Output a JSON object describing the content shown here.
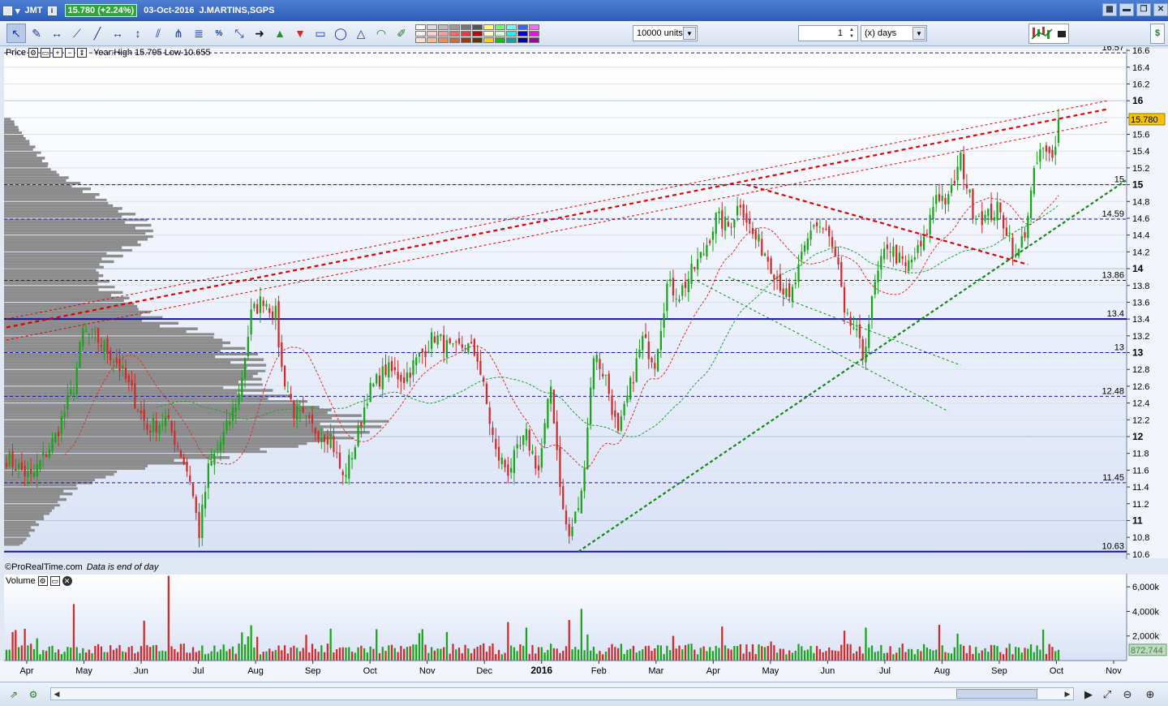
{
  "titlebar": {
    "symbol": "JMT",
    "price_badge": "15.780 (+2.24%)",
    "date": "03-Oct-2016",
    "instrument": "J.MARTINS,SGPS"
  },
  "toolbar": {
    "units_value": "10000 units",
    "period_value": "1",
    "period_unit": "(x) days",
    "swatch_colors": [
      "#ffffff",
      "#dddddd",
      "#bbbbbb",
      "#999999",
      "#777777",
      "#555555",
      "#ffff66",
      "#66ff66",
      "#66ffff",
      "#3366ff",
      "#ff66ff",
      "#ffeeee",
      "#ffcccc",
      "#ff9999",
      "#ff6666",
      "#ff3333",
      "#cc0000",
      "#ffffcc",
      "#ccffcc",
      "#00ffff",
      "#0000ff",
      "#ff00ff",
      "#ffe0cc",
      "#ffbb88",
      "#ff8844",
      "#dd6622",
      "#aa3300",
      "#663300",
      "#ffcc00",
      "#00cc00",
      "#00aaaa",
      "#0000aa",
      "#aa00aa"
    ]
  },
  "price_panel": {
    "label": "Price",
    "year_info": "Year:High 15.795 Low 10.655",
    "credit": "©ProRealTime.com",
    "credit_note": "Data is end of day"
  },
  "volume_panel": {
    "label": "Volume"
  },
  "colors": {
    "up": "#19a519",
    "down": "#d12a2a",
    "hline": "#1515a0",
    "resistance": "#e00000",
    "support": "#128a12",
    "profile": "#8c8c8c",
    "last_price": "#f5c400"
  },
  "chart_data": {
    "type": "candlestick",
    "title": "JMT 03-Oct-2016 J.MARTINS,SGPS",
    "y_range": [
      10.55,
      16.62
    ],
    "y_ticks": [
      16.6,
      16.4,
      16.2,
      16,
      15.8,
      15.6,
      15.4,
      15.2,
      15,
      14.8,
      14.6,
      14.4,
      14.2,
      14,
      13.8,
      13.6,
      13.4,
      13.2,
      13,
      12.8,
      12.6,
      12.4,
      12.2,
      12,
      11.8,
      11.6,
      11.4,
      11.2,
      11,
      10.8,
      10.6
    ],
    "y_ticks_bold": [
      16,
      15,
      14,
      13,
      12,
      11
    ],
    "x_labels": [
      "Apr",
      "May",
      "Jun",
      "Jul",
      "Aug",
      "Sep",
      "Oct",
      "Nov",
      "Dec",
      "2016",
      "Feb",
      "Mar",
      "Apr",
      "May",
      "Jun",
      "Jul",
      "Aug",
      "Sep",
      "Oct",
      "Nov"
    ],
    "x_bold": "2016",
    "horizontal_levels": [
      {
        "value": 16.57,
        "label": "16.57",
        "style": "dashed"
      },
      {
        "value": 15.0,
        "label": "15",
        "style": "dashed"
      },
      {
        "value": 14.59,
        "label": "14.59",
        "style": "dashed"
      },
      {
        "value": 13.86,
        "label": "13.86",
        "style": "dashed"
      },
      {
        "value": 13.4,
        "label": "13.4",
        "style": "solid"
      },
      {
        "value": 13.0,
        "label": "13",
        "style": "dashed"
      },
      {
        "value": 12.48,
        "label": "12.48",
        "style": "dashed"
      },
      {
        "value": 11.45,
        "label": "11.45",
        "style": "dashed"
      },
      {
        "value": 10.63,
        "label": "10.63",
        "style": "solid"
      }
    ],
    "last_price": {
      "value": 15.78,
      "label": "15.780"
    },
    "anchors": [
      {
        "x": 0,
        "v": 11.75
      },
      {
        "x": 8,
        "v": 11.5
      },
      {
        "x": 16,
        "v": 12.0
      },
      {
        "x": 22,
        "v": 12.6
      },
      {
        "x": 25,
        "v": 13.25
      },
      {
        "x": 30,
        "v": 13.15
      },
      {
        "x": 36,
        "v": 12.9
      },
      {
        "x": 40,
        "v": 12.6
      },
      {
        "x": 46,
        "v": 12.1
      },
      {
        "x": 52,
        "v": 12.2
      },
      {
        "x": 56,
        "v": 11.9
      },
      {
        "x": 60,
        "v": 11.5
      },
      {
        "x": 63,
        "v": 10.85
      },
      {
        "x": 66,
        "v": 11.6
      },
      {
        "x": 72,
        "v": 12.1
      },
      {
        "x": 76,
        "v": 12.5
      },
      {
        "x": 80,
        "v": 13.45
      },
      {
        "x": 84,
        "v": 13.65
      },
      {
        "x": 88,
        "v": 13.45
      },
      {
        "x": 90,
        "v": 12.8
      },
      {
        "x": 94,
        "v": 12.3
      },
      {
        "x": 100,
        "v": 12.1
      },
      {
        "x": 106,
        "v": 12.0
      },
      {
        "x": 110,
        "v": 11.5
      },
      {
        "x": 114,
        "v": 11.9
      },
      {
        "x": 118,
        "v": 12.5
      },
      {
        "x": 124,
        "v": 12.8
      },
      {
        "x": 130,
        "v": 12.7
      },
      {
        "x": 136,
        "v": 13.0
      },
      {
        "x": 140,
        "v": 13.2
      },
      {
        "x": 146,
        "v": 13.0
      },
      {
        "x": 150,
        "v": 13.1
      },
      {
        "x": 154,
        "v": 12.95
      },
      {
        "x": 160,
        "v": 11.8
      },
      {
        "x": 164,
        "v": 11.6
      },
      {
        "x": 170,
        "v": 12.0
      },
      {
        "x": 174,
        "v": 11.6
      },
      {
        "x": 178,
        "v": 12.6
      },
      {
        "x": 182,
        "v": 11.1
      },
      {
        "x": 184,
        "v": 10.8
      },
      {
        "x": 188,
        "v": 11.3
      },
      {
        "x": 192,
        "v": 13.0
      },
      {
        "x": 196,
        "v": 12.7
      },
      {
        "x": 200,
        "v": 12.0
      },
      {
        "x": 204,
        "v": 12.6
      },
      {
        "x": 208,
        "v": 13.15
      },
      {
        "x": 212,
        "v": 12.9
      },
      {
        "x": 216,
        "v": 13.8
      },
      {
        "x": 220,
        "v": 13.7
      },
      {
        "x": 224,
        "v": 13.95
      },
      {
        "x": 228,
        "v": 14.2
      },
      {
        "x": 232,
        "v": 14.6
      },
      {
        "x": 236,
        "v": 14.5
      },
      {
        "x": 240,
        "v": 14.8
      },
      {
        "x": 244,
        "v": 14.4
      },
      {
        "x": 248,
        "v": 14.2
      },
      {
        "x": 252,
        "v": 13.9
      },
      {
        "x": 256,
        "v": 13.6
      },
      {
        "x": 260,
        "v": 14.1
      },
      {
        "x": 264,
        "v": 14.55
      },
      {
        "x": 268,
        "v": 14.45
      },
      {
        "x": 272,
        "v": 14.0
      },
      {
        "x": 274,
        "v": 13.4
      },
      {
        "x": 277,
        "v": 13.3
      },
      {
        "x": 280,
        "v": 12.95
      },
      {
        "x": 284,
        "v": 13.8
      },
      {
        "x": 288,
        "v": 14.3
      },
      {
        "x": 294,
        "v": 14.0
      },
      {
        "x": 300,
        "v": 14.3
      },
      {
        "x": 304,
        "v": 14.9
      },
      {
        "x": 308,
        "v": 14.8
      },
      {
        "x": 312,
        "v": 15.3
      },
      {
        "x": 316,
        "v": 14.7
      },
      {
        "x": 320,
        "v": 14.6
      },
      {
        "x": 324,
        "v": 14.7
      },
      {
        "x": 328,
        "v": 14.4
      },
      {
        "x": 330,
        "v": 14.1
      },
      {
        "x": 333,
        "v": 14.45
      },
      {
        "x": 336,
        "v": 15.1
      },
      {
        "x": 338,
        "v": 15.4
      },
      {
        "x": 342,
        "v": 15.3
      },
      {
        "x": 344,
        "v": 15.78
      }
    ],
    "trendlines": [
      {
        "name": "channel-upper-thin",
        "x1": 0,
        "v1": 13.4,
        "x2": 360,
        "v2": 16.0,
        "color": "#e00000",
        "dash": "3,3",
        "width": 1
      },
      {
        "name": "channel-mid-bold",
        "x1": 0,
        "v1": 13.3,
        "x2": 360,
        "v2": 15.9,
        "color": "#e00000",
        "dash": "5,4",
        "width": 2.2
      },
      {
        "name": "channel-lower-thin",
        "x1": 0,
        "v1": 13.15,
        "x2": 360,
        "v2": 15.75,
        "color": "#e00000",
        "dash": "3,3",
        "width": 1
      },
      {
        "name": "resistance-down",
        "x1": 242,
        "v1": 15.0,
        "x2": 334,
        "v2": 14.05,
        "color": "#e00000",
        "dash": "5,4",
        "width": 2.2
      },
      {
        "name": "support-up",
        "x1": 187,
        "v1": 10.63,
        "x2": 366,
        "v2": 15.05,
        "color": "#128a12",
        "dash": "4,3",
        "width": 2.2
      },
      {
        "name": "support-fan-1",
        "x1": 226,
        "v1": 13.85,
        "x2": 308,
        "v2": 12.3,
        "color": "#128a12",
        "dash": "3,3",
        "width": 1
      },
      {
        "name": "support-fan-2",
        "x1": 236,
        "v1": 13.9,
        "x2": 312,
        "v2": 12.85,
        "color": "#128a12",
        "dash": "3,3",
        "width": 1
      }
    ],
    "volume": {
      "y_ticks": [
        6000,
        4000,
        2000
      ],
      "y_tick_labels": [
        "6,000k",
        "4,000k",
        "2,000k"
      ],
      "y_max": 7000,
      "last_label": "872,744",
      "last_value": 872744
    },
    "price_profile": {
      "levels": [
        15.8,
        15.6,
        15.4,
        15.2,
        15.0,
        14.8,
        14.6,
        14.4,
        14.2,
        14.0,
        13.8,
        13.6,
        13.4,
        13.2,
        13.0,
        12.8,
        12.6,
        12.4,
        12.2,
        12.0,
        11.8,
        11.6,
        11.4,
        11.2,
        11.0,
        10.8,
        10.7
      ],
      "widths": [
        0.02,
        0.05,
        0.09,
        0.12,
        0.2,
        0.27,
        0.35,
        0.38,
        0.3,
        0.24,
        0.27,
        0.33,
        0.4,
        0.55,
        0.62,
        0.66,
        0.63,
        0.78,
        0.94,
        0.88,
        0.6,
        0.3,
        0.18,
        0.14,
        0.09,
        0.06,
        0.04
      ]
    }
  }
}
